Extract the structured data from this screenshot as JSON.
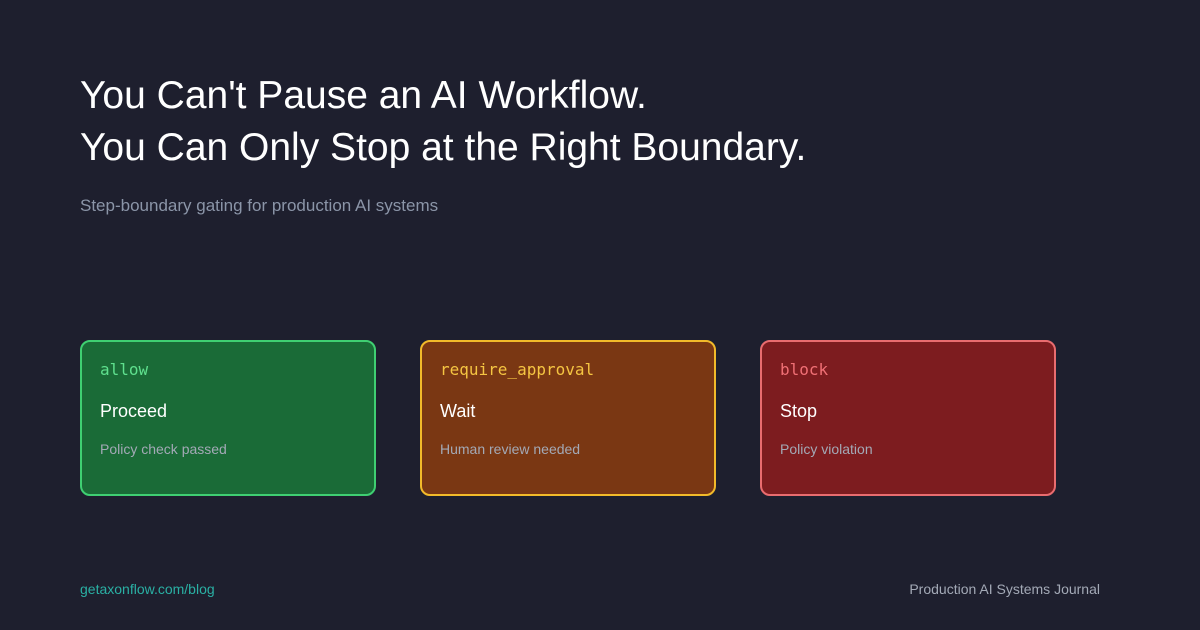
{
  "header": {
    "title_line1": "You Can't Pause an AI Workflow.",
    "title_line2": "You Can Only Stop at the Right Boundary.",
    "subtitle": "Step-boundary gating for production AI systems"
  },
  "cards": [
    {
      "decision": "allow",
      "action": "Proceed",
      "detail": "Policy check passed",
      "colors": {
        "background": "#1a6b37",
        "border": "#3fcf72",
        "code": "#5fe08e"
      }
    },
    {
      "decision": "require_approval",
      "action": "Wait",
      "detail": "Human review needed",
      "colors": {
        "background": "#7a3713",
        "border": "#f2ba2a",
        "code": "#f5c542"
      }
    },
    {
      "decision": "block",
      "action": "Stop",
      "detail": "Policy violation",
      "colors": {
        "background": "#7d1c1f",
        "border": "#e96c6f",
        "code": "#f07075"
      }
    }
  ],
  "footer": {
    "link": "getaxonflow.com/blog",
    "brand": "Production AI Systems Journal"
  },
  "theme": {
    "background": "#1e1f2e",
    "title": "#ffffff",
    "muted": "#8b95a8",
    "accent_link": "#2ab0a4"
  }
}
